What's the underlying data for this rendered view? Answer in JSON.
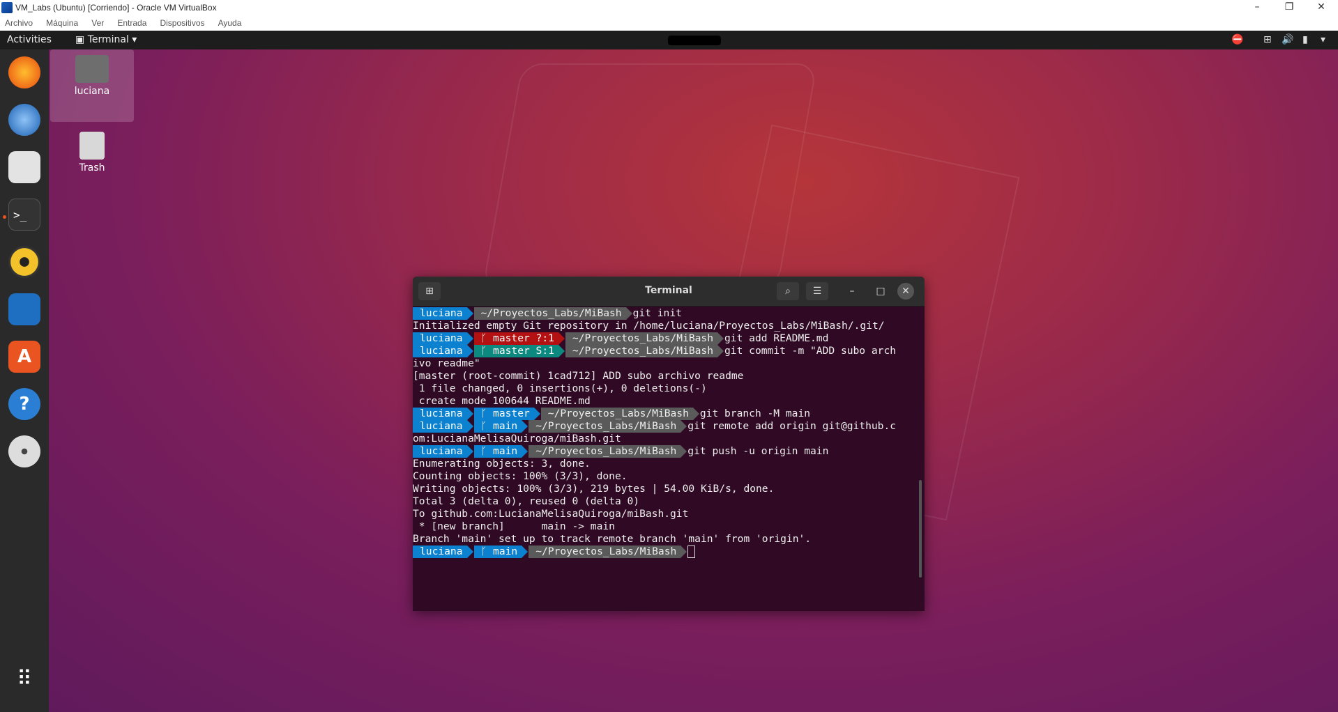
{
  "host": {
    "title": "VM_Labs (Ubuntu) [Corriendo] - Oracle VM VirtualBox",
    "menu": [
      "Archivo",
      "Máquina",
      "Ver",
      "Entrada",
      "Dispositivos",
      "Ayuda"
    ]
  },
  "topbar": {
    "activities": "Activities",
    "app_menu": "Terminal"
  },
  "desktop": {
    "home_label": "luciana",
    "trash_label": "Trash"
  },
  "terminal": {
    "title": "Terminal",
    "prompt_user": "luciana",
    "prompt_path": "~/Proyectos_Labs/MiBash",
    "lines": [
      {
        "type": "prompt",
        "git": "",
        "cmd": "git init"
      },
      {
        "type": "out",
        "text": "Initialized empty Git repository in /home/luciana/Proyectos_Labs/MiBash/.git/"
      },
      {
        "type": "prompt",
        "git": "master ?:1",
        "git_style": "red",
        "cmd": "git add README.md"
      },
      {
        "type": "prompt",
        "git": "master S:1",
        "git_style": "teal",
        "cmd": "git commit -m \"ADD subo arch"
      },
      {
        "type": "out",
        "text": "ivo readme\""
      },
      {
        "type": "out",
        "text": "[master (root-commit) 1cad712] ADD subo archivo readme"
      },
      {
        "type": "out",
        "text": " 1 file changed, 0 insertions(+), 0 deletions(-)"
      },
      {
        "type": "out",
        "text": " create mode 100644 README.md"
      },
      {
        "type": "prompt",
        "git": "master",
        "git_style": "blue",
        "cmd": "git branch -M main"
      },
      {
        "type": "prompt",
        "git": "main",
        "git_style": "blue",
        "cmd": "git remote add origin git@github.c"
      },
      {
        "type": "out",
        "text": "om:LucianaMelisaQuiroga/miBash.git"
      },
      {
        "type": "prompt",
        "git": "main",
        "git_style": "blue",
        "cmd": "git push -u origin main"
      },
      {
        "type": "out",
        "text": "Enumerating objects: 3, done."
      },
      {
        "type": "out",
        "text": "Counting objects: 100% (3/3), done."
      },
      {
        "type": "out",
        "text": "Writing objects: 100% (3/3), 219 bytes | 54.00 KiB/s, done."
      },
      {
        "type": "out",
        "text": "Total 3 (delta 0), reused 0 (delta 0)"
      },
      {
        "type": "out",
        "text": "To github.com:LucianaMelisaQuiroga/miBash.git"
      },
      {
        "type": "out",
        "text": " * [new branch]      main -> main"
      },
      {
        "type": "out",
        "text": "Branch 'main' set up to track remote branch 'main' from 'origin'."
      },
      {
        "type": "prompt",
        "git": "main",
        "git_style": "blue",
        "cmd": "",
        "cursor": true
      }
    ]
  },
  "dock": {
    "apps": [
      "firefox-icon",
      "thunderbird-icon",
      "files-icon",
      "terminal-icon",
      "rhythmbox-icon",
      "writer-icon",
      "software-icon",
      "help-icon",
      "disc-icon"
    ]
  }
}
